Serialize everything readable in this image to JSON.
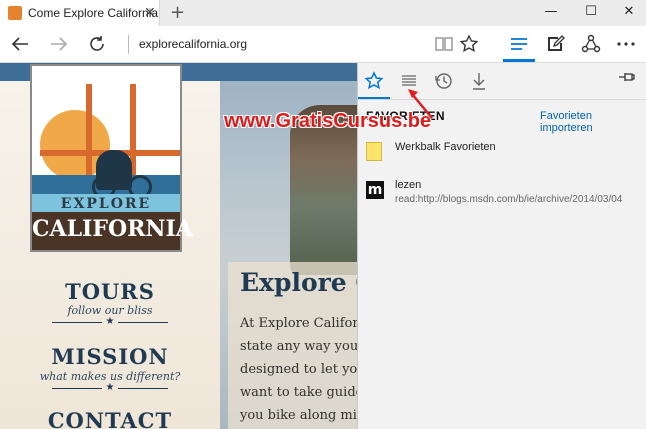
{
  "browser": {
    "tab_title": "Come Explore California",
    "tab_close": "✕",
    "new_tab": "+",
    "window_controls": [
      "—",
      "☐",
      "✕"
    ],
    "address": "explorecalifornia.org",
    "icons": [
      "back-icon",
      "forward-icon",
      "refresh-icon",
      "reading-view-icon",
      "favorites-star-icon",
      "hub-icon",
      "web-note-icon",
      "share-icon",
      "more-icon"
    ]
  },
  "page": {
    "logo_explore": "EXPLORE",
    "logo_california": "CALIFORNIA",
    "nav": [
      {
        "title": "TOURS",
        "subtitle": "follow our bliss"
      },
      {
        "title": "MISSION",
        "subtitle": "what makes us different?"
      },
      {
        "title": "CONTACT"
      }
    ],
    "content_title": "Explore C",
    "content_lines": [
      "At Explore Californi",
      "state any way you pl",
      "designed to let you e",
      "want to take guided",
      "you bike along miles"
    ]
  },
  "watermark": "www.GratisCursus.be",
  "hub": {
    "icons": [
      "favorites-icon",
      "reading-list-icon",
      "history-icon",
      "downloads-icon",
      "pin-icon"
    ],
    "heading": "FAVORIETEN",
    "import_link": "Favorieten importeren",
    "items": [
      {
        "label": "Werkbalk Favorieten",
        "icon": "folder-icon"
      },
      {
        "label": "lezen",
        "url": "read:http://blogs.msdn.com/b/ie/archive/2014/03/04",
        "icon": "m-icon"
      }
    ]
  },
  "colors": {
    "accent": "#0078d7",
    "navy": "#1f3a52",
    "watermark": "#e01b1b"
  }
}
